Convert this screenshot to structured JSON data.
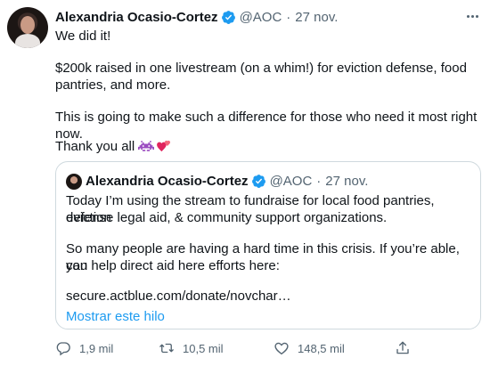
{
  "tweet": {
    "author_name": "Alexandria Ocasio-Cortez",
    "handle": "@AOC",
    "separator": "·",
    "date": "27 nov.",
    "lines": [
      "We did it!",
      "$200k raised in one livestream (on a whim!) for eviction defense, food",
      "pantries, and more.",
      "This is going to make such a difference for those who need it most right now.",
      "Thank you all"
    ]
  },
  "quote": {
    "author_name": "Alexandria Ocasio-Cortez",
    "handle": "@AOC",
    "separator": "·",
    "date": "27 nov.",
    "lines": [
      "Today I’m using the stream to fundraise for local food pantries, eviction",
      "defense legal aid, & community support organizations.",
      "So many people are having a hard time in this crisis. If you’re able, you",
      "can help direct aid here efforts here:",
      "secure.actblue.com/donate/novchar…"
    ],
    "show_thread": "Mostrar este hilo"
  },
  "actions": {
    "replies": "1,9 mil",
    "retweets": "10,5 mil",
    "likes": "148,5 mil"
  },
  "colors": {
    "verified": "#1d9bf0",
    "link": "#1d9bf0",
    "muted": "#536471"
  },
  "icons": [
    "verified-badge-icon",
    "more-icon",
    "space-invader-emoji-icon",
    "two-hearts-emoji-icon",
    "reply-icon",
    "retweet-icon",
    "like-icon",
    "share-icon"
  ]
}
